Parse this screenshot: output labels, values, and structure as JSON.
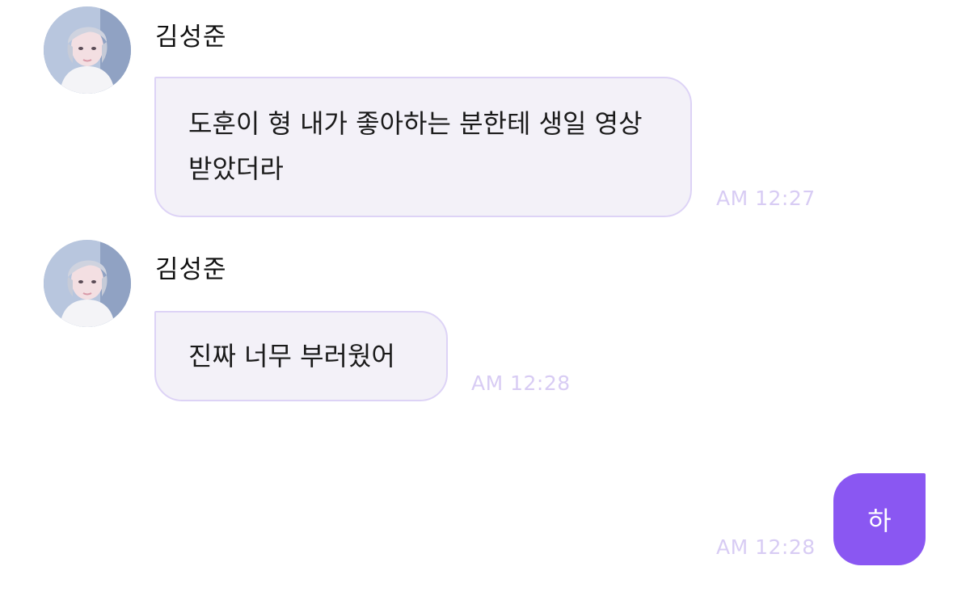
{
  "messages": [
    {
      "sender": "김성준",
      "text": "도훈이 형 내가 좋아하는 분한테 생일 영상 받았더라",
      "time": "AM 12:27"
    },
    {
      "sender": "김성준",
      "text": "진짜 너무 부러웠어",
      "time": "AM 12:28"
    },
    {
      "text": "하",
      "time": "AM 12:28"
    }
  ],
  "colors": {
    "incoming_bubble": "#f3f1f8",
    "incoming_border": "#ddd3f6",
    "outgoing_bubble": "#8a57f2",
    "timestamp": "#d8ccf4"
  }
}
